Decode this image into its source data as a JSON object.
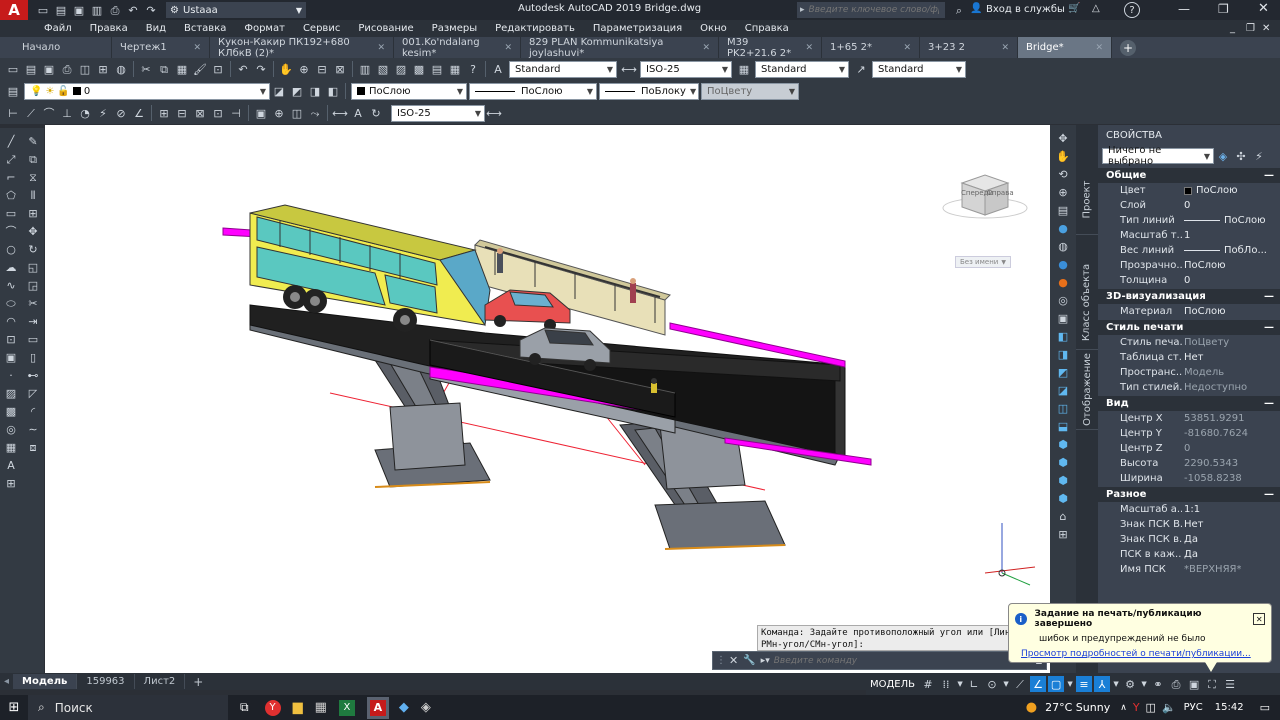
{
  "titlebar": {
    "logo": "A",
    "workspace": "Ustaaa",
    "title": "Autodesk AutoCAD 2019   Bridge.dwg",
    "search_placeholder": "Введите ключевое слово/фразу",
    "signin": "Вход в службы",
    "help": "?"
  },
  "menu": [
    "Файл",
    "Правка",
    "Вид",
    "Вставка",
    "Формат",
    "Сервис",
    "Рисование",
    "Размеры",
    "Редактировать",
    "Параметризация",
    "Окно",
    "Справка"
  ],
  "tabs": [
    {
      "label": "Начало",
      "active": false
    },
    {
      "label": "Чертеж1",
      "active": false
    },
    {
      "label": "Кукон-Какир ПК192+680 КЛбкВ (2)*",
      "active": false
    },
    {
      "label": "001.Ko'ndalang kesim*",
      "active": false
    },
    {
      "label": "829 PLAN  Kommunikatsiya joylashuvi*",
      "active": false
    },
    {
      "label": "M39 PK2+21.6 2*",
      "active": false
    },
    {
      "label": "1+65 2*",
      "active": false
    },
    {
      "label": "3+23 2",
      "active": false
    },
    {
      "label": "Bridge*",
      "active": true
    }
  ],
  "toolbar1": {
    "text_style": "Standard",
    "dim_style": "ISO-25",
    "table_style": "Standard",
    "mleader_style": "Standard"
  },
  "toolbar2": {
    "layer": "0",
    "color": "ПоСлою",
    "linetype": "ПоСлою",
    "lineweight": "ПоБлоку",
    "plotstyle": "ПоЦвету"
  },
  "toolbar3": {
    "dim_style": "ISO-25"
  },
  "viewcube": {
    "left": "Спереди",
    "right": "Справа",
    "named_view": "Без имени"
  },
  "vtabs": [
    "Проект",
    "Класс объекта",
    "Отображение"
  ],
  "properties": {
    "title": "СВОЙСТВА",
    "selection": "Ничего не выбрано",
    "sections": [
      {
        "name": "Общие",
        "rows": [
          {
            "label": "Цвет",
            "value": "ПоСлою",
            "swatch": true
          },
          {
            "label": "Слой",
            "value": "0"
          },
          {
            "label": "Тип линий",
            "value": "ПоСлою",
            "line": true
          },
          {
            "label": "Масштаб т...",
            "value": "1"
          },
          {
            "label": "Вес линий",
            "value": "ПобЛо...",
            "line": true
          },
          {
            "label": "Прозрачно...",
            "value": "ПоСлою"
          },
          {
            "label": "Толщина",
            "value": "0"
          }
        ]
      },
      {
        "name": "3D-визуализация",
        "rows": [
          {
            "label": "Материал",
            "value": "ПоСлою"
          }
        ]
      },
      {
        "name": "Стиль печати",
        "rows": [
          {
            "label": "Стиль печа...",
            "value": "ПоЦвету",
            "dim": true
          },
          {
            "label": "Таблица ст...",
            "value": "Нет"
          },
          {
            "label": "Пространс...",
            "value": "Модель",
            "dim": true
          },
          {
            "label": "Тип стилей...",
            "value": "Недоступно",
            "dim": true
          }
        ]
      },
      {
        "name": "Вид",
        "rows": [
          {
            "label": "Центр X",
            "value": "53851.9291",
            "dim": true
          },
          {
            "label": "Центр Y",
            "value": "-81680.7624",
            "dim": true
          },
          {
            "label": "Центр Z",
            "value": "0",
            "dim": true
          },
          {
            "label": "Высота",
            "value": "2290.5343",
            "dim": true
          },
          {
            "label": "Ширина",
            "value": "-1058.8238",
            "dim": true
          }
        ]
      },
      {
        "name": "Разное",
        "rows": [
          {
            "label": "Масштаб а...",
            "value": "1:1"
          },
          {
            "label": "Знак ПСК В...",
            "value": "Нет"
          },
          {
            "label": "Знак ПСК в...",
            "value": "Да"
          },
          {
            "label": "ПСК в каж...",
            "value": "Да"
          },
          {
            "label": "Имя ПСК",
            "value": "*ВЕРХНЯЯ*",
            "dim": true
          }
        ]
      }
    ]
  },
  "command": {
    "history1": "Команда: Задайте противоположный угол или [Линия/",
    "history2": "РМн-угол/СМн-угол]:",
    "placeholder": "Введите команду"
  },
  "notice": {
    "title": "Задание на печать/публикацию завершено",
    "line1": "шибок и предупреждений не было",
    "link": "Просмотр подробностей о печати/публикации..."
  },
  "layout_tabs": [
    {
      "label": "Модель",
      "active": true
    },
    {
      "label": "159963",
      "active": false
    },
    {
      "label": "Лист2",
      "active": false
    }
  ],
  "status": {
    "model": "МОДЕЛЬ"
  },
  "taskbar": {
    "search": "Поиск",
    "weather": "27°C  Sunny",
    "lang": "РУС",
    "time": "15:42"
  },
  "colors": {
    "accent": "#c61b1b",
    "highlight": "#ff00ff",
    "blue": "#1a7fd6"
  }
}
